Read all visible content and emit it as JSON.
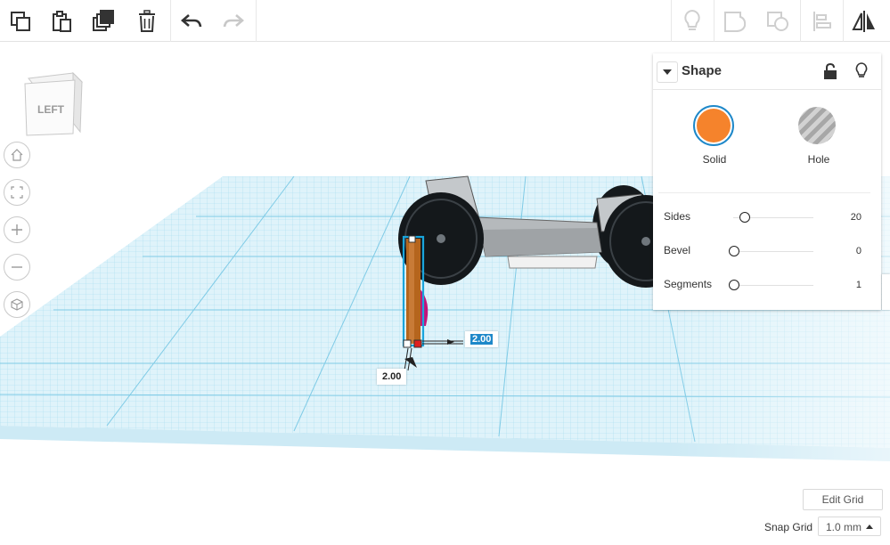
{
  "toolbar": {
    "left_tools": [
      "copy-icon",
      "paste-icon",
      "duplicate-icon",
      "trash-icon",
      "undo-icon",
      "redo-icon"
    ],
    "right_tools": [
      "lightbulb-icon",
      "group-icon",
      "ungroup-icon",
      "align-icon",
      "mirror-icon"
    ]
  },
  "view_cube": {
    "face_label": "LEFT"
  },
  "nav_controls": [
    "home-view-icon",
    "fit-view-icon",
    "zoom-in-icon",
    "zoom-out-icon",
    "ortho-view-icon"
  ],
  "shape_panel": {
    "title": "Shape",
    "solid_label": "Solid",
    "hole_label": "Hole",
    "solid_color": "#f5832c",
    "params": [
      {
        "label": "Sides",
        "value": "20",
        "fraction": 0.12
      },
      {
        "label": "Bevel",
        "value": "0",
        "fraction": 0.0
      },
      {
        "label": "Segments",
        "value": "1",
        "fraction": 0.0
      }
    ]
  },
  "dimensions": {
    "width_value": "2.00",
    "depth_value": "2.00"
  },
  "grid": {
    "edit_label": "Edit Grid",
    "snap_label": "Snap Grid",
    "snap_value": "1.0 mm"
  },
  "colors": {
    "grid_line": "#8fd3ea",
    "grid_bg": "#dff3fa",
    "accent": "#1e88c9"
  }
}
